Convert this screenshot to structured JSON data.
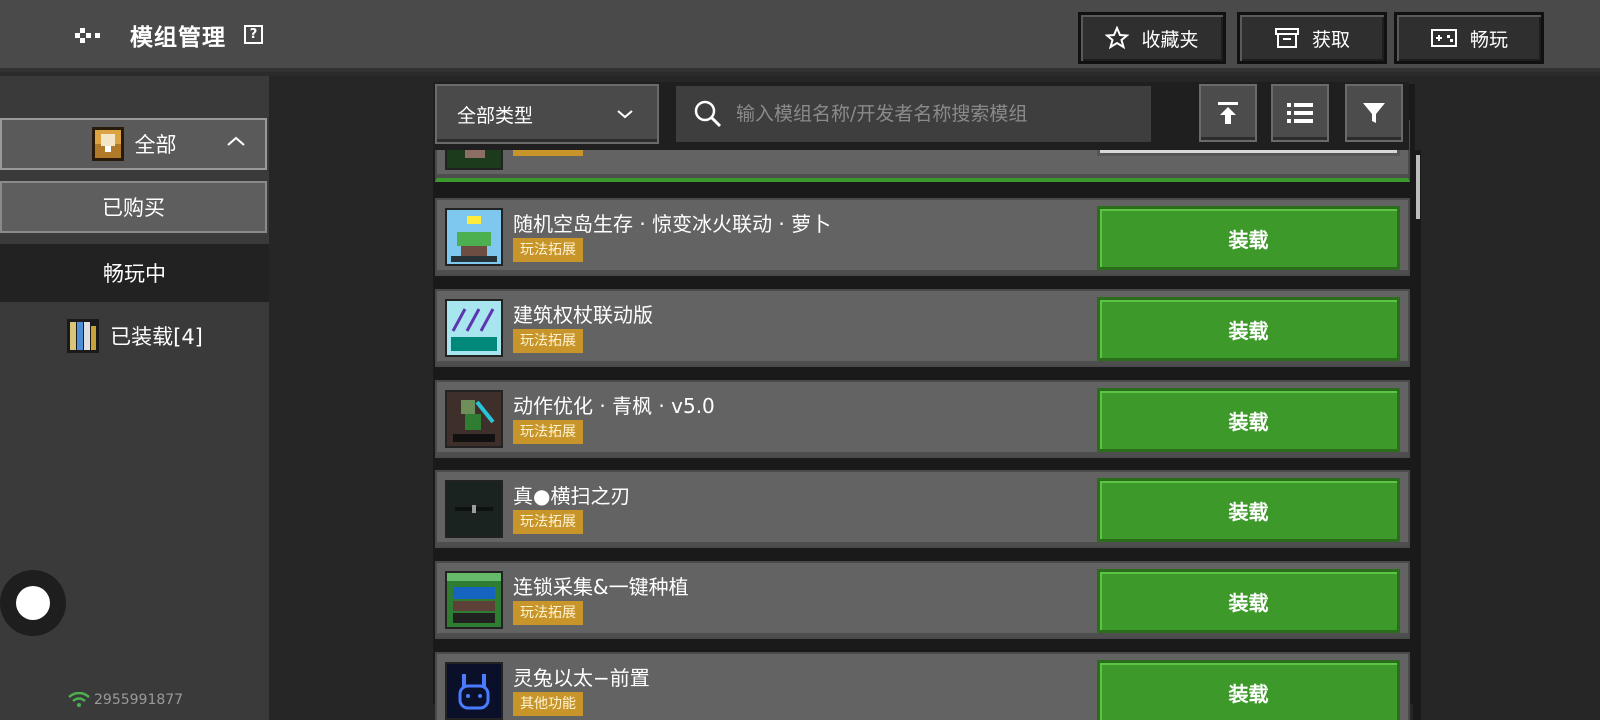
{
  "header": {
    "title": "模组管理",
    "help": "?",
    "buttons": [
      {
        "label": "收藏夹",
        "icon": "star-icon"
      },
      {
        "label": "获取",
        "icon": "store-icon"
      },
      {
        "label": "畅玩",
        "icon": "gamepad-icon"
      }
    ]
  },
  "sidebar": {
    "items": [
      {
        "label": "全部",
        "icon": "chest-icon"
      },
      {
        "label": "已购买"
      },
      {
        "label": "畅玩中"
      },
      {
        "label": "已装载[4]",
        "icon": "books-icon"
      }
    ],
    "user_id": "2955991877"
  },
  "toolbar": {
    "type_select": "全部类型",
    "search_placeholder": "输入模组名称/开发者名称搜索模组"
  },
  "mods": [
    {
      "name": "",
      "tag": "玩法拓展",
      "button": ""
    },
    {
      "name": "随机空岛生存 · 惊变冰火联动 · 萝卜",
      "tag": "玩法拓展",
      "button": "装载"
    },
    {
      "name": "建筑权杖联动版",
      "tag": "玩法拓展",
      "button": "装载"
    },
    {
      "name": "动作优化 · 青枫 · v5.0",
      "tag": "玩法拓展",
      "button": "装载"
    },
    {
      "name": "真●横扫之刃",
      "tag": "玩法拓展",
      "button": "装载"
    },
    {
      "name": "连锁采集&一键种植",
      "tag": "玩法拓展",
      "button": "装载"
    },
    {
      "name": "灵兔以太−前置",
      "tag": "其他功能",
      "button": "装载"
    }
  ],
  "colors": {
    "accent_green": "#3d9a2a",
    "tag_gold": "#c7952a"
  }
}
